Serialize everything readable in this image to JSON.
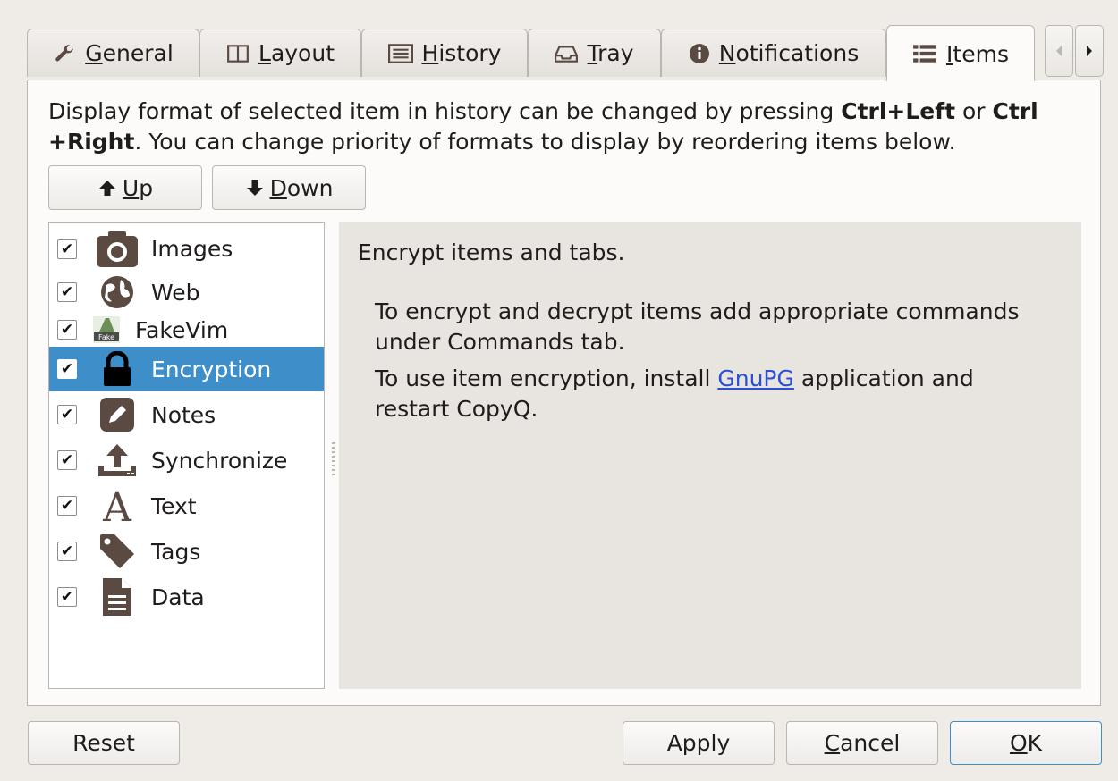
{
  "tabs": [
    {
      "label_pre": "",
      "label_acc": "G",
      "label_post": "eneral",
      "icon": "wrench-icon"
    },
    {
      "label_pre": "",
      "label_acc": "L",
      "label_post": "ayout",
      "icon": "columns-icon"
    },
    {
      "label_pre": "",
      "label_acc": "H",
      "label_post": "istory",
      "icon": "list-box-icon"
    },
    {
      "label_pre": "",
      "label_acc": "T",
      "label_post": "ray",
      "icon": "tray-icon"
    },
    {
      "label_pre": "",
      "label_acc": "N",
      "label_post": "otifications",
      "icon": "info-icon"
    },
    {
      "label_pre": "",
      "label_acc": "I",
      "label_post": "tems",
      "icon": "list-icon",
      "active": true
    }
  ],
  "description": {
    "part1": "Display format of selected item in history can be changed by pressing ",
    "key1": "Ctrl+Left",
    "part2": " or ",
    "key2": "Ctrl +Right",
    "part3": ". You can change priority of formats to display by reordering items below."
  },
  "order_buttons": {
    "up": {
      "acc": "U",
      "rest": "p"
    },
    "down": {
      "acc": "D",
      "rest": "own"
    }
  },
  "items": [
    {
      "label": "Images",
      "checked": true,
      "icon": "camera-icon"
    },
    {
      "label": "Web",
      "checked": true,
      "icon": "globe-icon"
    },
    {
      "label": "FakeVim",
      "checked": true,
      "icon": "fakevim-icon"
    },
    {
      "label": "Encryption",
      "checked": true,
      "icon": "lock-icon",
      "selected": true
    },
    {
      "label": "Notes",
      "checked": true,
      "icon": "pencil-icon"
    },
    {
      "label": "Synchronize",
      "checked": true,
      "icon": "upload-icon"
    },
    {
      "label": "Text",
      "checked": true,
      "icon": "font-icon"
    },
    {
      "label": "Tags",
      "checked": true,
      "icon": "tag-icon"
    },
    {
      "label": "Data",
      "checked": true,
      "icon": "file-icon"
    }
  ],
  "detail": {
    "title": "Encrypt items and tabs.",
    "para1": "To encrypt and decrypt items add appropriate commands under Commands tab.",
    "para2_pre": "To use item encryption, install ",
    "para2_link": "GnuPG",
    "para2_post": " application and restart CopyQ."
  },
  "footer": {
    "reset": "Reset",
    "apply": "Apply",
    "cancel": {
      "acc": "C",
      "rest": "ancel"
    },
    "ok": {
      "acc": "O",
      "rest": "K"
    }
  },
  "colors": {
    "selection": "#3d8ec9",
    "link": "#2b4fd1",
    "icon": "#5a4a42"
  }
}
